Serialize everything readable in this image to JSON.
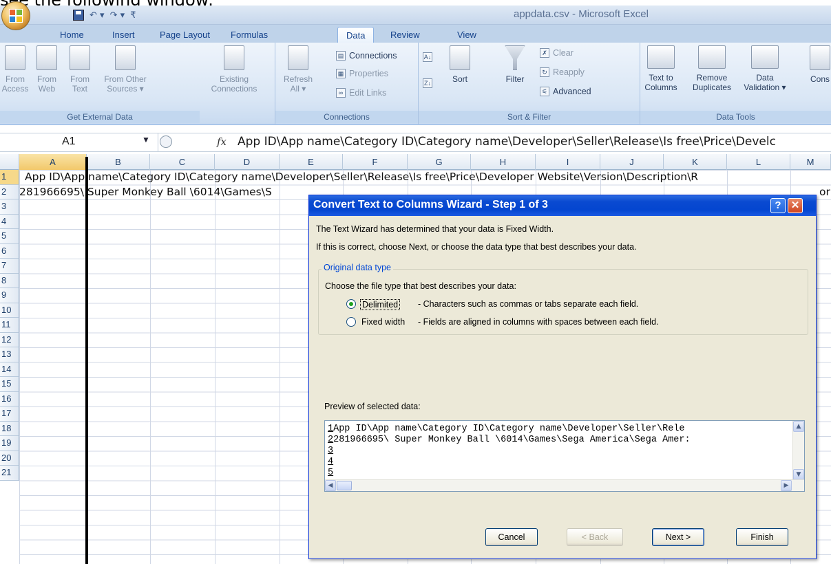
{
  "caption": "see the following window:",
  "window": {
    "title": "appdata.csv - Microsoft Excel",
    "qat": {
      "undo": "↶ ▾",
      "redo": "↷ ▾",
      "customize": "₹"
    }
  },
  "ribbon_tabs": [
    "Home",
    "Insert",
    "Page Layout",
    "Formulas",
    "Data",
    "Review",
    "View"
  ],
  "active_tab": "Data",
  "groups": {
    "get_external": {
      "label": "Get External Data",
      "buttons": [
        {
          "l1": "From",
          "l2": "Access"
        },
        {
          "l1": "From",
          "l2": "Web"
        },
        {
          "l1": "From",
          "l2": "Text"
        },
        {
          "l1": "From Other",
          "l2": "Sources ▾"
        },
        {
          "l1": "Existing",
          "l2": "Connections"
        }
      ]
    },
    "connections": {
      "label": "Connections",
      "refresh_l1": "Refresh",
      "refresh_l2": "All ▾",
      "connections": "Connections",
      "properties": "Properties",
      "edit_links": "Edit Links"
    },
    "sort_filter": {
      "label": "Sort & Filter",
      "sort": "Sort",
      "filter": "Filter",
      "clear": "Clear",
      "reapply": "Reapply",
      "advanced": "Advanced"
    },
    "data_tools": {
      "label": "Data Tools",
      "text_to_columns_l1": "Text to",
      "text_to_columns_l2": "Columns",
      "remove_dup_l1": "Remove",
      "remove_dup_l2": "Duplicates",
      "validation_l1": "Data",
      "validation_l2": "Validation ▾",
      "consolidate": "Cons"
    }
  },
  "formula_bar": {
    "name_box": "A1",
    "fx": "fx",
    "content": "App ID\\App name\\Category ID\\Category name\\Developer\\Seller\\Release\\Is free\\Price\\Develc"
  },
  "columns": [
    "A",
    "B",
    "C",
    "D",
    "E",
    "F",
    "G",
    "H",
    "I",
    "J",
    "K",
    "L",
    "M"
  ],
  "rows": [
    "1",
    "2",
    "3",
    "4",
    "5",
    "6",
    "7",
    "8",
    "9",
    "10",
    "11",
    "12",
    "13",
    "14",
    "15",
    "16",
    "17",
    "18",
    "19",
    "20",
    "21"
  ],
  "cells": {
    "row1": "App ID\\App name\\Category ID\\Category name\\Developer\\Seller\\Release\\Is free\\Price\\Developer Website\\Version\\Description\\R",
    "row2": "281966695\\ Super Monkey Ball \\6014\\Games\\S",
    "row2_tail": "or"
  },
  "dialog": {
    "title": "Convert Text to Columns Wizard - Step 1 of 3",
    "help": "?",
    "close": "✕",
    "line1": "The Text Wizard has determined that your data is Fixed Width.",
    "line2": "If this is correct, choose Next, or choose the data type that best describes your data.",
    "group_label": "Original data type",
    "choose": "Choose the file type that best describes your data:",
    "options": [
      {
        "label": "Delimited",
        "desc": "- Characters such as commas or tabs separate each field.",
        "selected": true
      },
      {
        "label": "Fixed width",
        "desc": "- Fields are aligned in columns with spaces between each field.",
        "selected": false
      }
    ],
    "preview_label": "Preview of selected data:",
    "preview_lines": [
      {
        "n": "1",
        "text": "App ID\\App name\\Category ID\\Category name\\Developer\\Seller\\Rele"
      },
      {
        "n": "2",
        "text": "281966695\\ Super Monkey Ball \\6014\\Games\\Sega America\\Sega Amer:"
      },
      {
        "n": "3",
        "text": ""
      },
      {
        "n": "4",
        "text": ""
      },
      {
        "n": "5",
        "text": ""
      }
    ],
    "buttons": {
      "cancel": "Cancel",
      "back": "< Back",
      "next": "Next >",
      "finish": "Finish"
    }
  },
  "colors": {
    "dialog_title": "#0a4ad1",
    "ribbon_text": "#15428b",
    "selection_header": "#f2c86a"
  }
}
